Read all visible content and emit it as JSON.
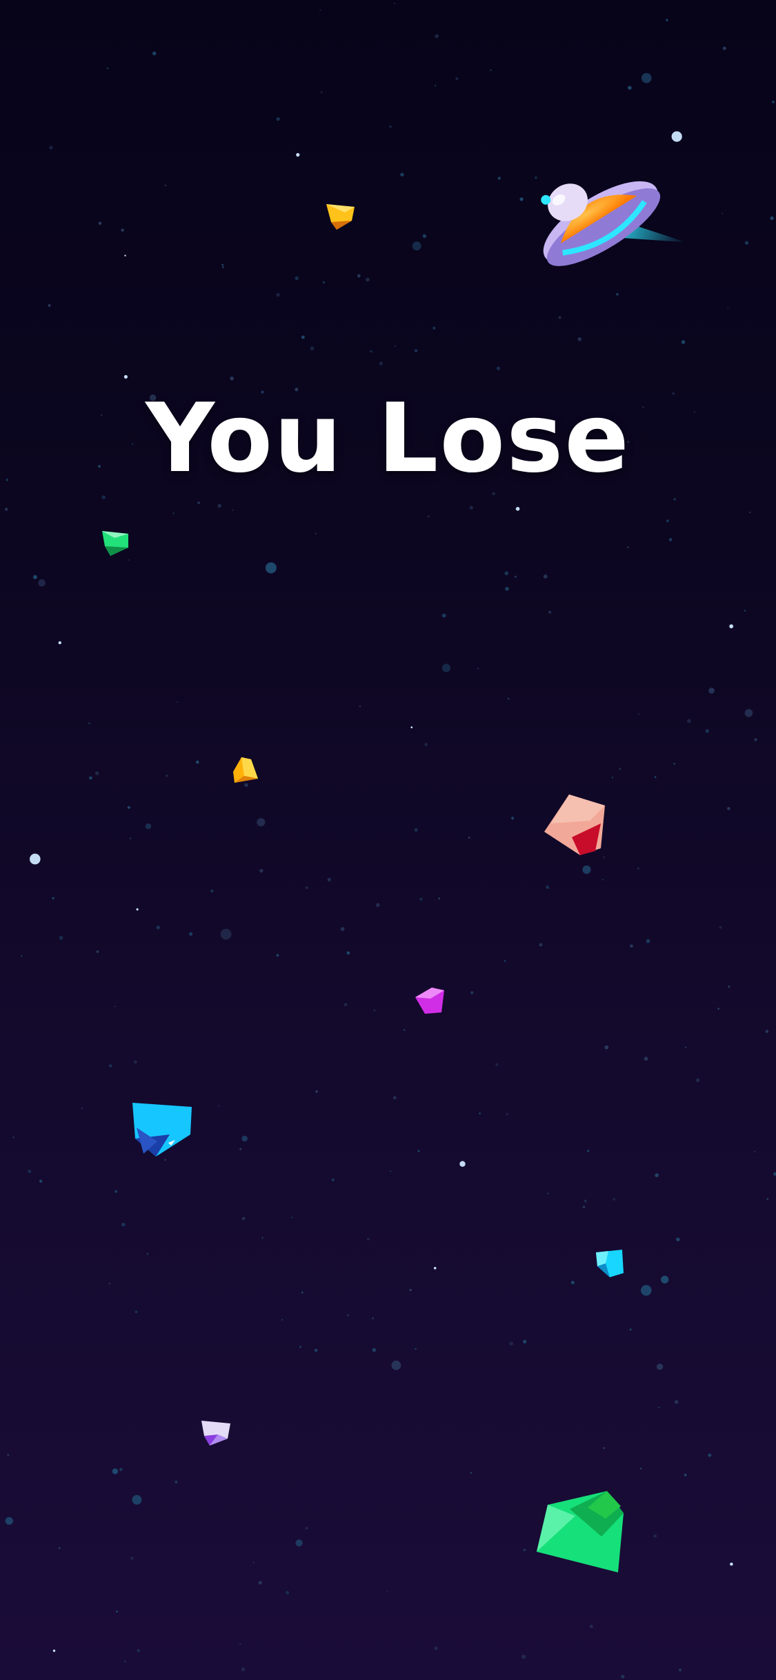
{
  "game": {
    "status_message": "You Lose"
  },
  "sprites": {
    "player": "ufo-spaceship",
    "gems": [
      "gold-gem",
      "green-gem",
      "gold-gem",
      "red-gem",
      "magenta-gem",
      "blue-gem",
      "cyan-gem",
      "lavender-gem",
      "green-gem"
    ]
  },
  "colors": {
    "background_top": "#07041a",
    "background_bottom": "#1a0c38",
    "title_text": "#ffffff",
    "ufo_dome": "#ff9a10",
    "ufo_hull": "#c7b6f2",
    "ufo_glow": "#2ee6ff"
  }
}
